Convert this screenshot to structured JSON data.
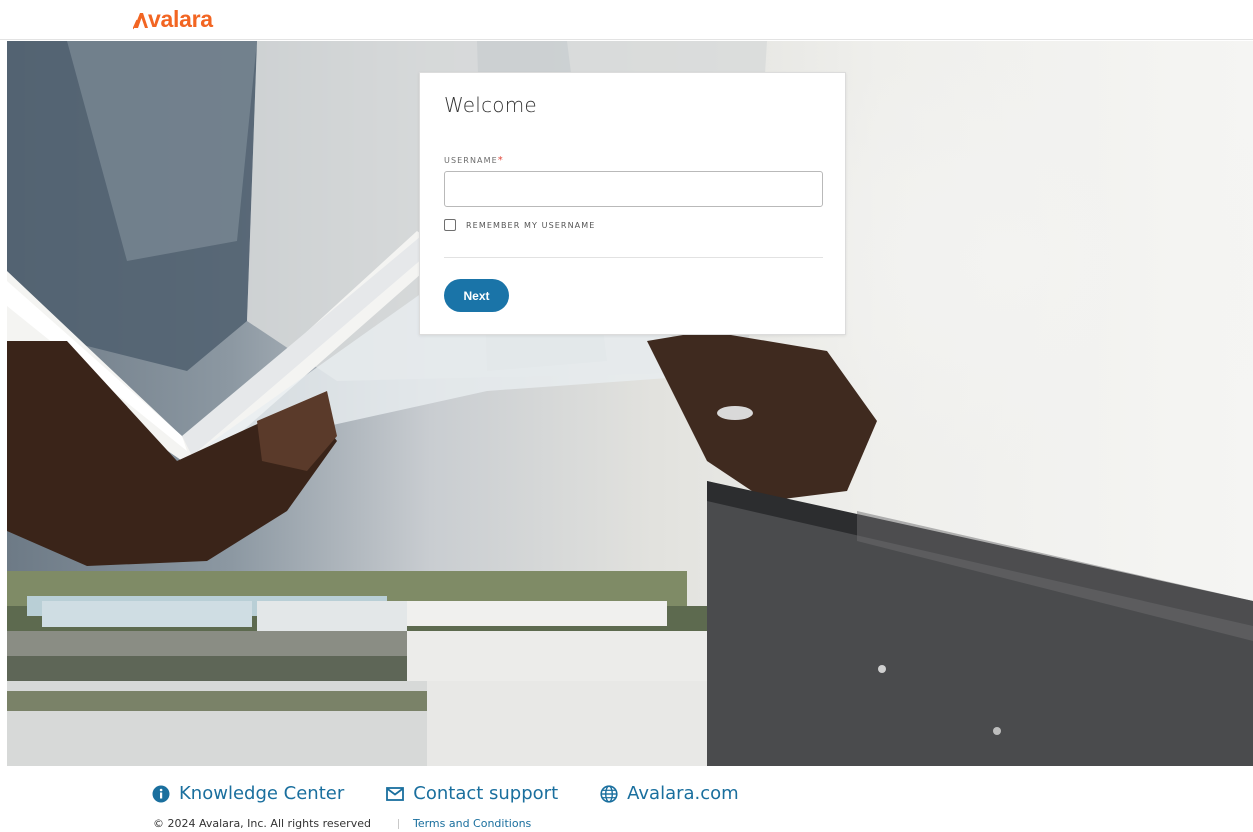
{
  "header": {
    "logo_text": "valara",
    "brand_color": "#f26522"
  },
  "login": {
    "title": "Welcome",
    "username_label": "USERNAME",
    "required_marker": "*",
    "username_value": "",
    "remember_label": "REMEMBER MY USERNAME",
    "remember_checked": false,
    "next_label": "Next",
    "button_color": "#1a74a8"
  },
  "footer": {
    "links": [
      {
        "icon": "info-icon",
        "label": "Knowledge Center"
      },
      {
        "icon": "mail-icon",
        "label": "Contact support"
      },
      {
        "icon": "globe-icon",
        "label": "Avalara.com"
      }
    ],
    "copyright": "© 2024 Avalara, Inc. All rights reserved",
    "terms_label": "Terms and Conditions",
    "link_color": "#1a6f9e"
  }
}
